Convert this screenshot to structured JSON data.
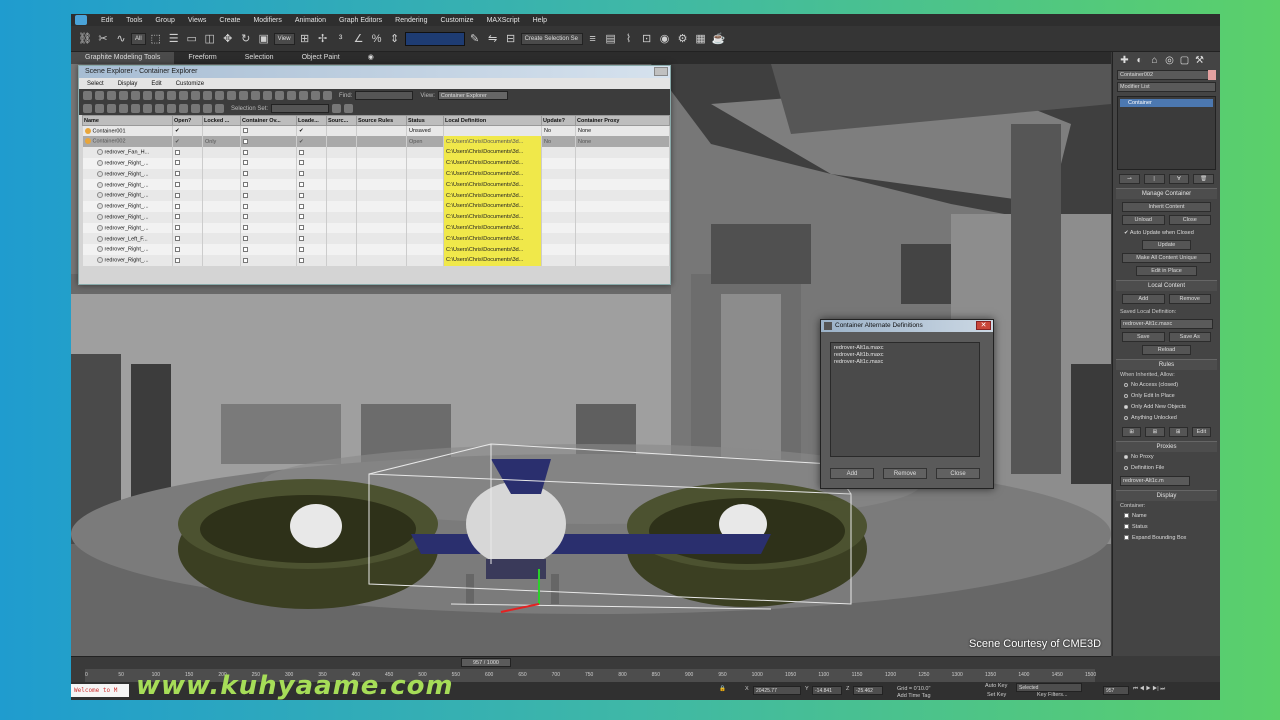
{
  "menu": [
    "Edit",
    "Tools",
    "Group",
    "Views",
    "Create",
    "Modifiers",
    "Animation",
    "Graph Editors",
    "Rendering",
    "Customize",
    "MAXScript",
    "Help"
  ],
  "toolbar": {
    "selection_filter": "All",
    "reference_coord": "View",
    "named_selection": "Create Selection Se"
  },
  "ribbon_tabs": [
    "Graphite Modeling Tools",
    "Freeform",
    "Selection",
    "Object Paint"
  ],
  "scene_explorer": {
    "title": "Scene Explorer - Container Explorer",
    "menu": [
      "Select",
      "Display",
      "Edit",
      "Customize"
    ],
    "find_label": "Find:",
    "view_label": "View:",
    "view_value": "Container Explorer",
    "selection_set_label": "Selection Set:",
    "columns": [
      "Name",
      "Open?",
      "Locked ...",
      "Container Ov...",
      "Loade...",
      "Sourc...",
      "Source Rules",
      "Status",
      "Local Definition",
      "Update?",
      "Container Proxy"
    ],
    "rows": [
      {
        "name": "Container001",
        "open": "✔",
        "locked": "",
        "override": "",
        "loaded": "✔",
        "status": "Unsaved",
        "def": "",
        "update": "No",
        "proxy": "None"
      },
      {
        "name": "Container002",
        "open": "✔",
        "locked": "Only",
        "override": "",
        "loaded": "✔",
        "status": "Open",
        "def": "C:\\Users\\Chris\\Documents\\3d...",
        "update": "No",
        "proxy": "None"
      },
      {
        "name": "redrover_Fan_H...",
        "def": "C:\\Users\\Chris\\Documents\\3d..."
      },
      {
        "name": "redrover_Right_...",
        "def": "C:\\Users\\Chris\\Documents\\3d..."
      },
      {
        "name": "redrover_Right_...",
        "def": "C:\\Users\\Chris\\Documents\\3d..."
      },
      {
        "name": "redrover_Right_...",
        "def": "C:\\Users\\Chris\\Documents\\3d..."
      },
      {
        "name": "redrover_Right_...",
        "def": "C:\\Users\\Chris\\Documents\\3d..."
      },
      {
        "name": "redrover_Right_...",
        "def": "C:\\Users\\Chris\\Documents\\3d..."
      },
      {
        "name": "redrover_Right_...",
        "def": "C:\\Users\\Chris\\Documents\\3d..."
      },
      {
        "name": "redrover_Right_...",
        "def": "C:\\Users\\Chris\\Documents\\3d..."
      },
      {
        "name": "redrover_Left_F...",
        "def": "C:\\Users\\Chris\\Documents\\3d..."
      },
      {
        "name": "redrover_Right_...",
        "def": "C:\\Users\\Chris\\Documents\\3d..."
      },
      {
        "name": "redrover_Right_...",
        "def": "C:\\Users\\Chris\\Documents\\3d..."
      }
    ]
  },
  "alt_dialog": {
    "title": "Container Alternate Definitions",
    "items": [
      "redrover-Alt1a.maxc",
      "redrover-Alt1b.maxc",
      "redrover-Alt1c.maxc"
    ],
    "buttons": [
      "Add",
      "Remove",
      "Close"
    ]
  },
  "cmdpanel": {
    "object_name": "Container002",
    "modifier_list": "Modifier List",
    "stack_item": "Container",
    "manage": {
      "title": "Manage Container",
      "inherit": "Inherit Content",
      "unload": "Unload",
      "close": "Close",
      "auto_update": "Auto Update when Closed",
      "update": "Update",
      "make_unique": "Make All Content Unique",
      "edit_in_place": "Edit in Place"
    },
    "local": {
      "title": "Local Content",
      "add": "Add",
      "remove": "Remove",
      "saved_label": "Saved Local Definition:",
      "saved_value": "redrover-Alt1c.maxc",
      "save": "Save",
      "save_as": "Save As",
      "reload": "Reload"
    },
    "rules": {
      "title": "Rules",
      "when": "When Inherited, Allow:",
      "options": [
        "No Access (closed)",
        "Only Edit In Place",
        "Only Add New Objects",
        "Anything Unlocked"
      ],
      "selected": 2,
      "edit": "Edit"
    },
    "proxies": {
      "title": "Proxies",
      "options": [
        "No Proxy",
        "Definition File"
      ],
      "selected": 0,
      "file": "redrover-Alt1c.m"
    },
    "display": {
      "title": "Display",
      "container_label": "Container:",
      "options": [
        "Name",
        "Status",
        "Expand Bounding Box"
      ]
    }
  },
  "timeline": {
    "slider": "957 / 1000",
    "ticks": [
      "0",
      "50",
      "100",
      "150",
      "200",
      "250",
      "300",
      "350",
      "400",
      "450",
      "500",
      "550",
      "600",
      "650",
      "700",
      "750",
      "800",
      "850",
      "900",
      "950",
      "1000",
      "1050",
      "1100",
      "1150",
      "1200",
      "1250",
      "1300",
      "1350",
      "1400",
      "1450",
      "1500"
    ]
  },
  "status": {
    "welcome": "Welcome to M",
    "x": "20425.77",
    "y": "-14.841",
    "z": "-25.462",
    "grid": "Grid = 0'10.0\"",
    "auto_key": "Auto Key",
    "selected": "Selected",
    "set_key": "Set Key",
    "key_filters": "Key Filters...",
    "add_time_tag": "Add Time Tag",
    "frame": "957"
  },
  "credit": "Scene Courtesy of CME3D",
  "watermark": "www.kuhyaame.com"
}
